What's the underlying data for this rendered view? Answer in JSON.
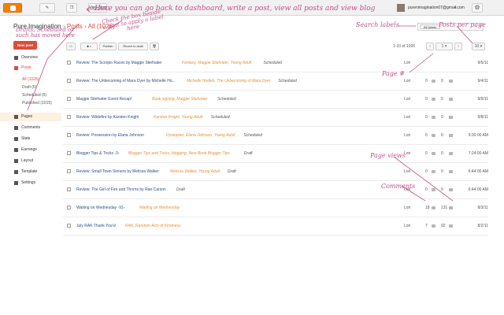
{
  "topbar": {
    "view_blog": "View blog",
    "account_email": "purenimagination07@gmail.com"
  },
  "header": {
    "blog_title": "Pure Imagination",
    "breadcrumb_sep": "›",
    "breadcrumb_posts": "Posts",
    "breadcrumb_all": "All (1026)"
  },
  "search": {
    "scope": "All labels"
  },
  "new_post": "New post",
  "sidebar": {
    "items": [
      {
        "label": "Overview",
        "icon": "home-icon"
      },
      {
        "label": "Posts",
        "icon": "posts-icon"
      },
      {
        "label": "Pages",
        "icon": "pages-icon"
      },
      {
        "label": "Comments",
        "icon": "comments-icon"
      },
      {
        "label": "Stats",
        "icon": "stats-icon"
      },
      {
        "label": "Earnings",
        "icon": "earnings-icon"
      },
      {
        "label": "Layout",
        "icon": "layout-icon"
      },
      {
        "label": "Template",
        "icon": "template-icon"
      },
      {
        "label": "Settings",
        "icon": "settings-icon"
      }
    ],
    "sub": [
      "All (1026)",
      "Draft (6)",
      "Scheduled (5)",
      "Published (1015)"
    ]
  },
  "toolbar": {
    "publish": "Publish",
    "revert": "Revert to draft"
  },
  "pager": {
    "range": "1-10 of 1026",
    "page": "1",
    "per_page": "10"
  },
  "posts": [
    {
      "title": "Review: The Scorpio Races by Maggie Stiefvater",
      "labels": "Fantasy, Maggie Stiefvater, Young Adult",
      "status": "Scheduled",
      "author": "Lori",
      "comments": "",
      "views": "",
      "date": "9/5/11"
    },
    {
      "title": "Review: The Unbecoming of Mara Dyer by Michelle Ho...",
      "labels": "Michelle Hodkin, The Unbecoming of Mara Dyer",
      "status": "Scheduled",
      "author": "Lori",
      "comments": "0",
      "views": "0",
      "date": "9/4/11"
    },
    {
      "title": "Maggie Stiefvater Event Recap!",
      "labels": "Book signing, Maggie Stiefvater",
      "status": "Scheduled",
      "author": "Lori",
      "comments": "0",
      "views": "0",
      "date": "9/9/11"
    },
    {
      "title": "Review: Wildefire by Karsten Knight",
      "labels": "Karsten Knight, Young Adult",
      "status": "Scheduled",
      "author": "Lori",
      "comments": "0",
      "views": "0",
      "date": "9/8/11"
    },
    {
      "title": "Review: Possession by Elana Johnson",
      "labels": "Dystopian, Elana Johnson, Young Adult",
      "status": "Scheduled",
      "author": "Lori",
      "comments": "0",
      "views": "0",
      "date": "9:30:00 AM"
    },
    {
      "title": "Blogger Tips & Tricks -3-",
      "labels": "Blogger Tips and Tricks, blogging, New Book Blogger Tips",
      "status": "Draft",
      "author": "Lori",
      "comments": "0",
      "views": "0",
      "date": "7:24:00 AM"
    },
    {
      "title": "Review: Small Town Sinners by Melissa Walker",
      "labels": "Melissa Walker, Young Adult",
      "status": "Draft",
      "author": "Lori",
      "comments": "0",
      "views": "0",
      "date": "6:44:00 AM"
    },
    {
      "title": "Review: The Girl of Fire and Thorns by Rae Carson",
      "labels": "",
      "status": "Draft",
      "author": "Lori",
      "comments": "0",
      "views": "0",
      "date": "6:44:00 AM"
    },
    {
      "title": "Waiting on Wednesday -91-",
      "labels": "Waiting on Wednesday",
      "status": "",
      "author": "Lori",
      "comments": "18",
      "views": "131",
      "date": "8/3/11"
    },
    {
      "title": "July RAK Thank You's!",
      "labels": "RAK, Random Acts of Kindness",
      "status": "",
      "author": "Lori",
      "comments": "7",
      "views": "92",
      "date": "8/2/11"
    }
  ],
  "annotations": {
    "top": "Here you can go back to dashboard, write a post, view all posts and view blog",
    "checkbox": [
      "Check the box beside",
      "a post to apply a label",
      "here"
    ],
    "drafts": [
      "Drafts, Scheduled or",
      "such has moved here"
    ],
    "search": "Search labels",
    "per_page": "Posts per page",
    "page_num": "Page #",
    "page_views": "Page views",
    "comments": "Comments"
  }
}
